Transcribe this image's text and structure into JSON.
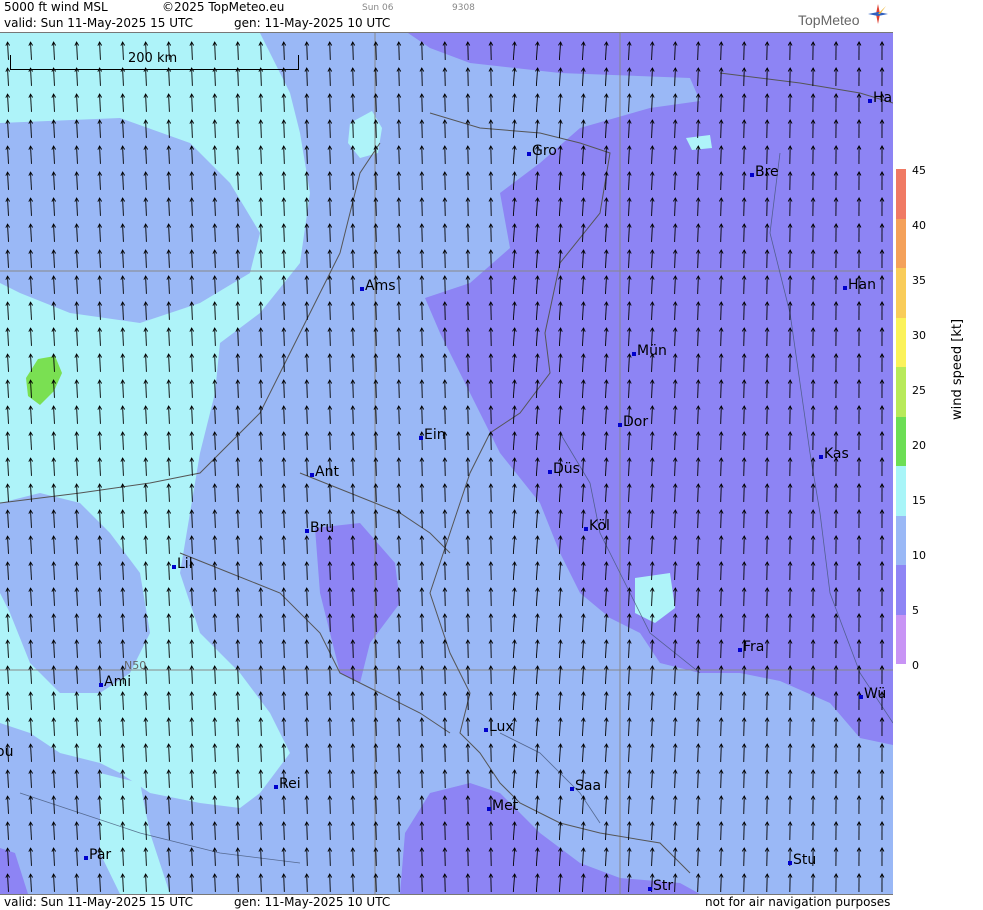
{
  "header": {
    "title": "5000 ft wind MSL",
    "copyright": "©2025 TopMeteo.eu",
    "small_a": "Sun 06",
    "small_b": "9308",
    "valid": "valid:  Sun  11-May-2025  15 UTC",
    "gen": "gen: 11-May-2025 10 UTC",
    "logo": "TopMeteo"
  },
  "footer": {
    "valid": "valid:  Sun  11-May-2025  15 UTC",
    "gen": "gen: 11-May-2025 10 UTC",
    "note": "not for air navigation purposes"
  },
  "scale": {
    "label": "200 km"
  },
  "grid_label": "N50",
  "cities": [
    {
      "name": "Ha"
    },
    {
      "name": "Gro"
    },
    {
      "name": "Bre"
    },
    {
      "name": "Ams"
    },
    {
      "name": "Han"
    },
    {
      "name": "Mün"
    },
    {
      "name": "Dor"
    },
    {
      "name": "Ein"
    },
    {
      "name": "Kas"
    },
    {
      "name": "Düs"
    },
    {
      "name": "Ant"
    },
    {
      "name": "Köl"
    },
    {
      "name": "Bru"
    },
    {
      "name": "Lil"
    },
    {
      "name": "Fra"
    },
    {
      "name": "Ami"
    },
    {
      "name": "Wü"
    },
    {
      "name": "ou"
    },
    {
      "name": "Lux"
    },
    {
      "name": "Rei"
    },
    {
      "name": "Saa"
    },
    {
      "name": "Met"
    },
    {
      "name": "Par"
    },
    {
      "name": "Stu"
    },
    {
      "name": "Str"
    }
  ],
  "colorbar": {
    "label": "wind  speed  [kt]",
    "ticks": [
      "45",
      "40",
      "35",
      "30",
      "25",
      "20",
      "15",
      "10",
      "5",
      "0"
    ],
    "colors": [
      "#f07a64",
      "#f4a15a",
      "#f9cc59",
      "#fbf25a",
      "#b8ea5a",
      "#6cde55",
      "#a8f5f8",
      "#9ab8f6",
      "#8f85f5",
      "#c894f5"
    ]
  },
  "colors": {
    "fast": "#8d84f4",
    "mid": "#9ab8f6",
    "slow": "#aef3f9",
    "green": "#7ae052",
    "border": "#555555",
    "river": "#445577"
  }
}
